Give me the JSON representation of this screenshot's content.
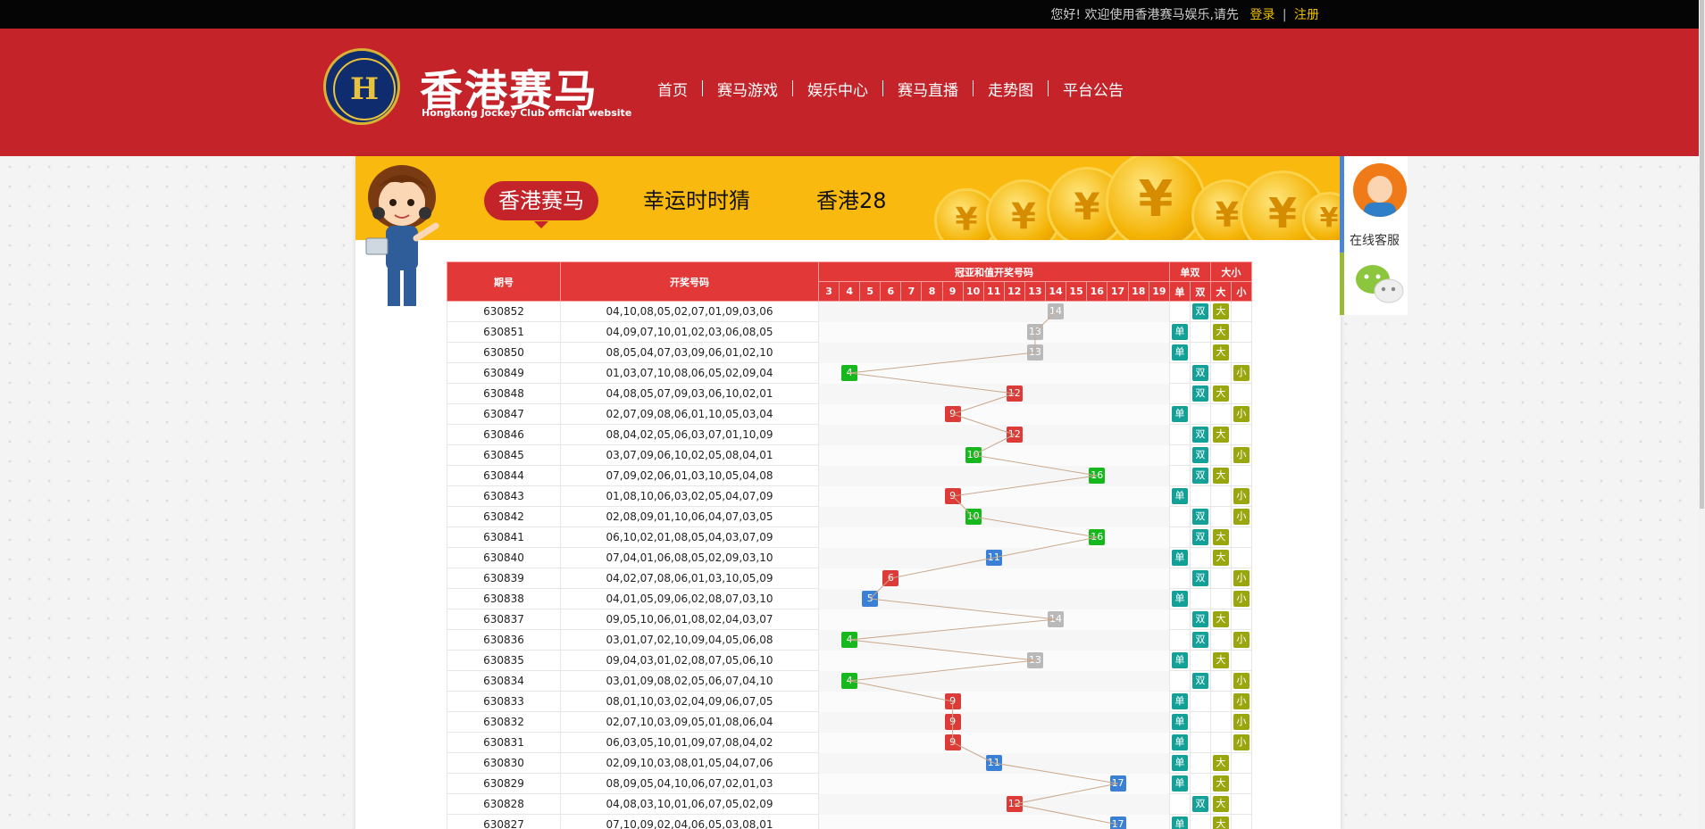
{
  "topbar": {
    "greeting": "您好! 欢迎使用香港赛马娱乐,请先",
    "login": "登录",
    "separator": "|",
    "register": "注册"
  },
  "header": {
    "brand": "香港赛马",
    "brand_sub": "Hongkong Jockey Club official website",
    "logo_icon": "jockey-club-logo",
    "nav": [
      "首页",
      "赛马游戏",
      "娱乐中心",
      "赛马直播",
      "走势图",
      "平台公告"
    ]
  },
  "banner": {
    "tabs": [
      "香港赛马",
      "幸运时时猜",
      "香港28"
    ],
    "active_tab": 0,
    "coin_symbol": "¥"
  },
  "table": {
    "headers": {
      "period": "期号",
      "numbers": "开奖号码",
      "sum_group": "冠亚和值开奖号码",
      "odd_even": "单双",
      "big_small": "大小",
      "odd": "单",
      "even": "双",
      "big": "大",
      "small": "小"
    },
    "sum_columns": [
      "3",
      "4",
      "5",
      "6",
      "7",
      "8",
      "9",
      "10",
      "11",
      "12",
      "13",
      "14",
      "15",
      "16",
      "17",
      "18",
      "19"
    ],
    "rows": [
      {
        "period": "630852",
        "numbers": "04,10,08,05,02,07,01,09,03,06",
        "sum": 14,
        "oe": "双",
        "bs": "大"
      },
      {
        "period": "630851",
        "numbers": "04,09,07,10,01,02,03,06,08,05",
        "sum": 13,
        "oe": "单",
        "bs": "大"
      },
      {
        "period": "630850",
        "numbers": "08,05,04,07,03,09,06,01,02,10",
        "sum": 13,
        "oe": "单",
        "bs": "大"
      },
      {
        "period": "630849",
        "numbers": "01,03,07,10,08,06,05,02,09,04",
        "sum": 4,
        "oe": "双",
        "bs": "小"
      },
      {
        "period": "630848",
        "numbers": "04,08,05,07,09,03,06,10,02,01",
        "sum": 12,
        "oe": "双",
        "bs": "大"
      },
      {
        "period": "630847",
        "numbers": "02,07,09,08,06,01,10,05,03,04",
        "sum": 9,
        "oe": "单",
        "bs": "小"
      },
      {
        "period": "630846",
        "numbers": "08,04,02,05,06,03,07,01,10,09",
        "sum": 12,
        "oe": "双",
        "bs": "大"
      },
      {
        "period": "630845",
        "numbers": "03,07,09,06,10,02,05,08,04,01",
        "sum": 10,
        "oe": "双",
        "bs": "小"
      },
      {
        "period": "630844",
        "numbers": "07,09,02,06,01,03,10,05,04,08",
        "sum": 16,
        "oe": "双",
        "bs": "大"
      },
      {
        "period": "630843",
        "numbers": "01,08,10,06,03,02,05,04,07,09",
        "sum": 9,
        "oe": "单",
        "bs": "小"
      },
      {
        "period": "630842",
        "numbers": "02,08,09,01,10,06,04,07,03,05",
        "sum": 10,
        "oe": "双",
        "bs": "小"
      },
      {
        "period": "630841",
        "numbers": "06,10,02,01,08,05,04,03,07,09",
        "sum": 16,
        "oe": "双",
        "bs": "大"
      },
      {
        "period": "630840",
        "numbers": "07,04,01,06,08,05,02,09,03,10",
        "sum": 11,
        "oe": "单",
        "bs": "大"
      },
      {
        "period": "630839",
        "numbers": "04,02,07,08,06,01,03,10,05,09",
        "sum": 6,
        "oe": "双",
        "bs": "小"
      },
      {
        "period": "630838",
        "numbers": "04,01,05,09,06,02,08,07,03,10",
        "sum": 5,
        "oe": "单",
        "bs": "小"
      },
      {
        "period": "630837",
        "numbers": "09,05,10,06,01,08,02,04,03,07",
        "sum": 14,
        "oe": "双",
        "bs": "大"
      },
      {
        "period": "630836",
        "numbers": "03,01,07,02,10,09,04,05,06,08",
        "sum": 4,
        "oe": "双",
        "bs": "小"
      },
      {
        "period": "630835",
        "numbers": "09,04,03,01,02,08,07,05,06,10",
        "sum": 13,
        "oe": "单",
        "bs": "大"
      },
      {
        "period": "630834",
        "numbers": "03,01,09,08,02,05,06,07,04,10",
        "sum": 4,
        "oe": "双",
        "bs": "小"
      },
      {
        "period": "630833",
        "numbers": "08,01,10,03,02,04,09,06,07,05",
        "sum": 9,
        "oe": "单",
        "bs": "小"
      },
      {
        "period": "630832",
        "numbers": "02,07,10,03,09,05,01,08,06,04",
        "sum": 9,
        "oe": "单",
        "bs": "小"
      },
      {
        "period": "630831",
        "numbers": "06,03,05,10,01,09,07,08,04,02",
        "sum": 9,
        "oe": "单",
        "bs": "小"
      },
      {
        "period": "630830",
        "numbers": "02,09,10,03,08,01,05,04,07,06",
        "sum": 11,
        "oe": "单",
        "bs": "大"
      },
      {
        "period": "630829",
        "numbers": "08,09,05,04,10,06,07,02,01,03",
        "sum": 17,
        "oe": "单",
        "bs": "大"
      },
      {
        "period": "630828",
        "numbers": "04,08,03,10,01,06,07,05,02,09",
        "sum": 12,
        "oe": "双",
        "bs": "大"
      },
      {
        "period": "630827",
        "numbers": "07,10,09,02,04,06,05,03,08,01",
        "sum": 17,
        "oe": "单",
        "bs": "大"
      }
    ]
  },
  "sidebar": {
    "service_label": "在线客服",
    "service_icon": "customer-service-avatar-icon",
    "wechat_icon": "wechat-icon"
  },
  "colors": {
    "header_red": "#c42429",
    "banner_yellow": "#f9b90f",
    "table_header": "#e23838",
    "odd_teal": "#12a098",
    "size_olive": "#9aa60e"
  }
}
